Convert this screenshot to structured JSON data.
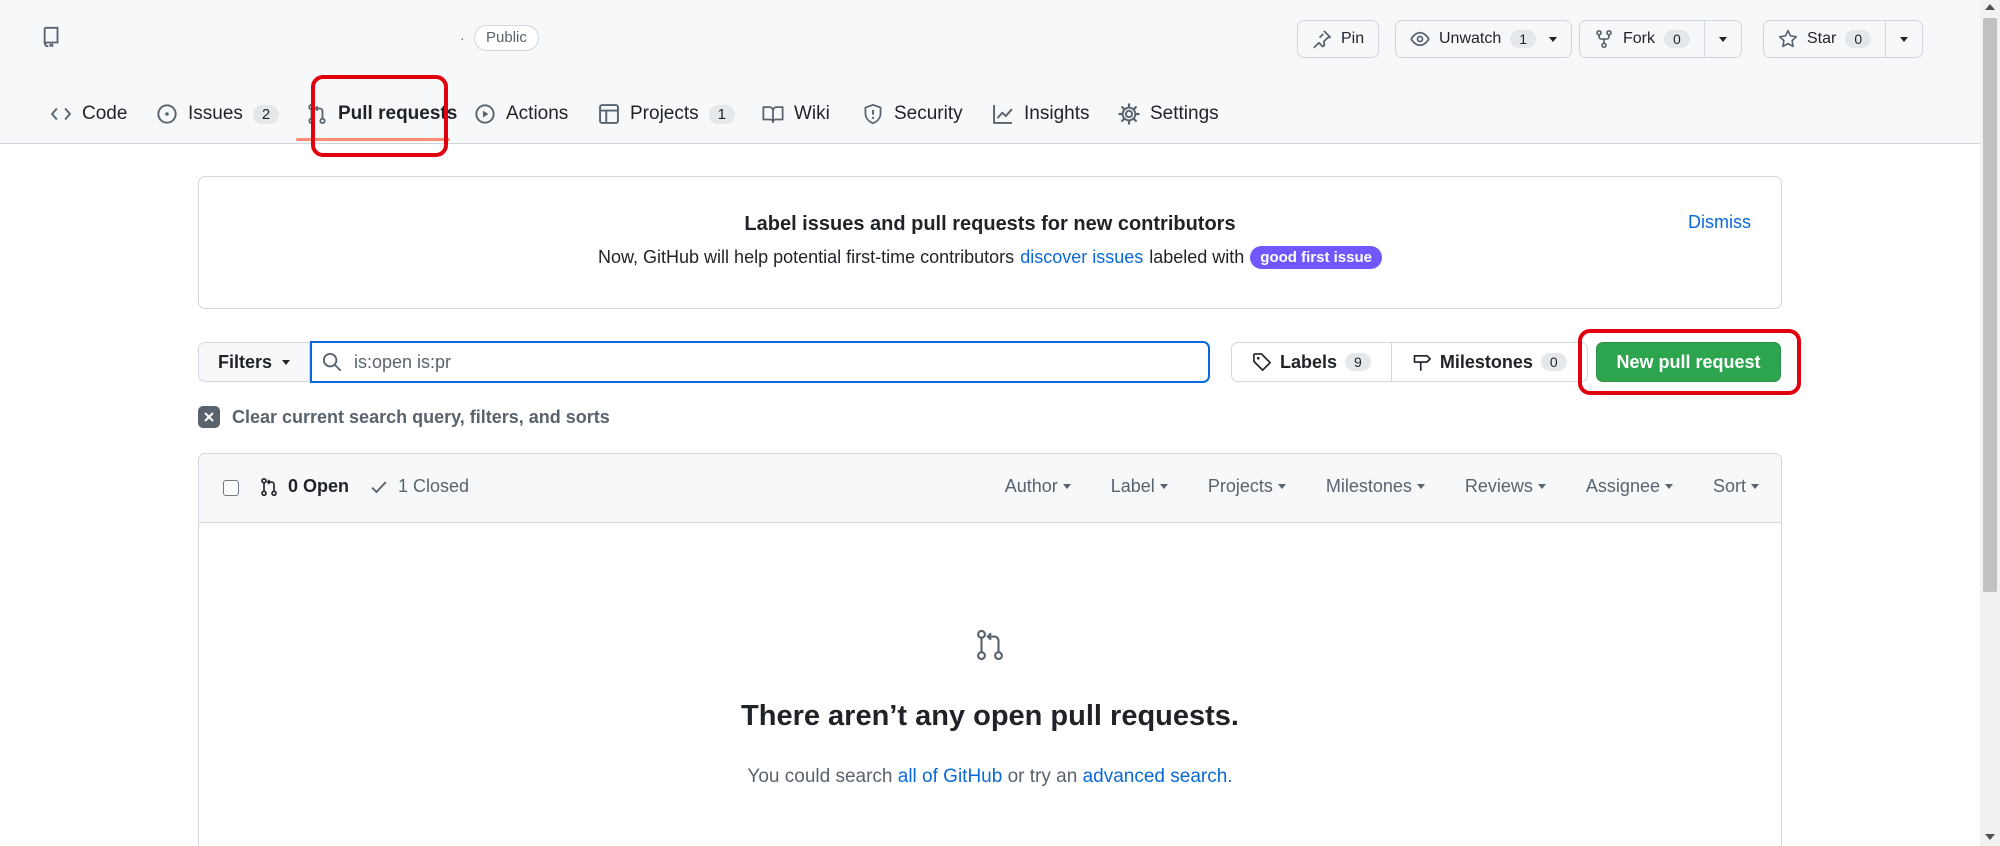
{
  "repo": {
    "visibility": "Public"
  },
  "actions": {
    "pin": "Pin",
    "unwatch": "Unwatch",
    "unwatch_count": "1",
    "fork": "Fork",
    "fork_count": "0",
    "star": "Star",
    "star_count": "0"
  },
  "tabs": [
    {
      "label": "Code",
      "icon": "code-icon"
    },
    {
      "label": "Issues",
      "icon": "issue-opened-icon",
      "count": "2"
    },
    {
      "label": "Pull requests",
      "icon": "git-pull-request-icon",
      "selected": true
    },
    {
      "label": "Actions",
      "icon": "play-icon"
    },
    {
      "label": "Projects",
      "icon": "table-icon",
      "count": "1"
    },
    {
      "label": "Wiki",
      "icon": "book-icon"
    },
    {
      "label": "Security",
      "icon": "shield-icon"
    },
    {
      "label": "Insights",
      "icon": "graph-icon"
    },
    {
      "label": "Settings",
      "icon": "gear-icon"
    }
  ],
  "banner": {
    "title": "Label issues and pull requests for new contributors",
    "text_before": "Now, GitHub will help potential first-time contributors",
    "link": "discover issues",
    "text_after": "labeled with",
    "label": "good first issue",
    "dismiss": "Dismiss"
  },
  "filters": {
    "button": "Filters",
    "search_value": "is:open is:pr",
    "labels": "Labels",
    "labels_count": "9",
    "milestones": "Milestones",
    "milestones_count": "0",
    "new_pr": "New pull request",
    "clear": "Clear current search query, filters, and sorts"
  },
  "list": {
    "open": "0 Open",
    "closed": "1 Closed",
    "menus": [
      "Author",
      "Label",
      "Projects",
      "Milestones",
      "Reviews",
      "Assignee",
      "Sort"
    ]
  },
  "blankslate": {
    "title": "There aren’t any open pull requests.",
    "text_before": "You could search",
    "link1": "all of GitHub",
    "text_mid": "or try an",
    "link2": "advanced search",
    "text_after": "."
  },
  "colors": {
    "accent": "#0969da",
    "primary_button": "#2da44e",
    "highlight": "#e0000e",
    "label_purple": "#7057ff"
  }
}
